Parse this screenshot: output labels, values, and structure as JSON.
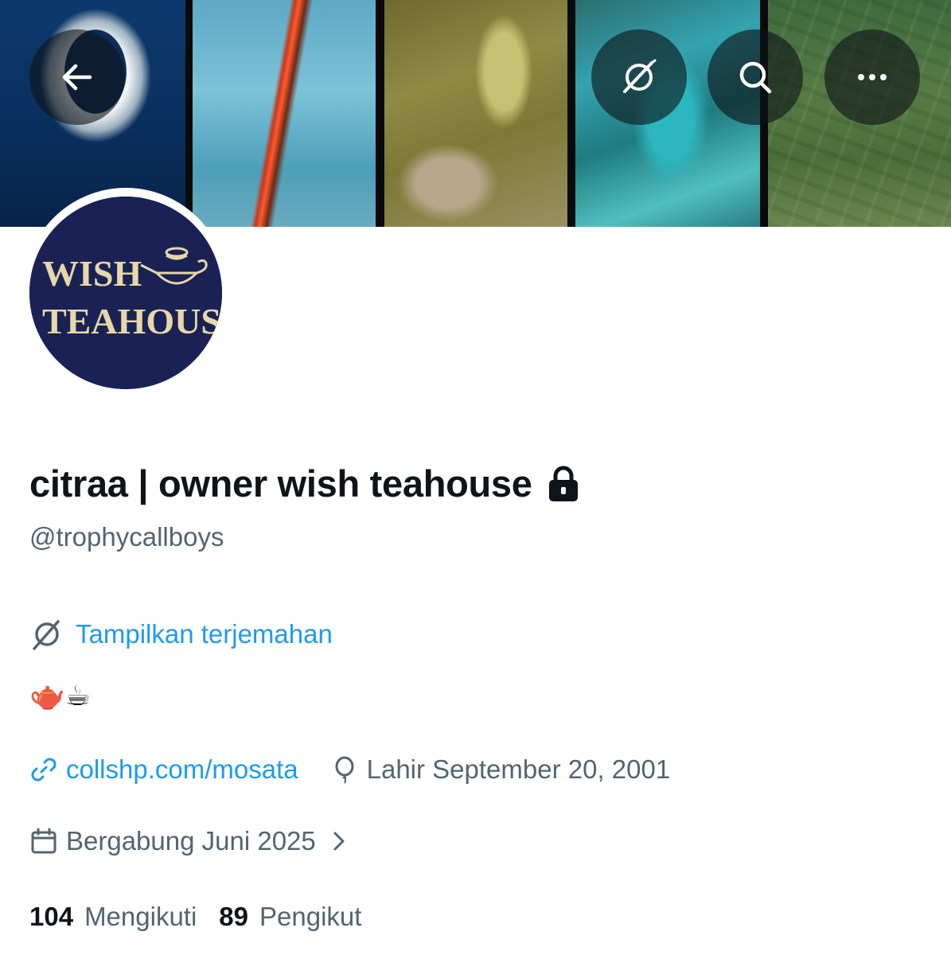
{
  "header": {
    "back_icon": "arrow-left-icon",
    "translate_icon": "translate-icon",
    "search_icon": "search-icon",
    "more_icon": "more-horizontal-icon"
  },
  "avatar": {
    "line1": "WISH",
    "line2": "TEAHOUSE",
    "background": "#1a2255",
    "text_color": "#e8d7a8"
  },
  "profile": {
    "display_name": "citraa | owner wish teahouse",
    "protected_icon": "lock-icon",
    "handle": "@trophycallboys",
    "translate_label": "Tampilkan terjemahan",
    "bio": "🫖☕",
    "link_text": "collshp.com/mosata",
    "birth_text": "Lahir September 20, 2001",
    "joined_text": "Bergabung Juni 2025"
  },
  "stats": {
    "following_count": "104",
    "following_label": "Mengikuti",
    "followers_count": "89",
    "followers_label": "Pengikut"
  },
  "colors": {
    "link": "#1d9bf0",
    "secondary_text": "#536471",
    "primary_text": "#0f1419"
  }
}
